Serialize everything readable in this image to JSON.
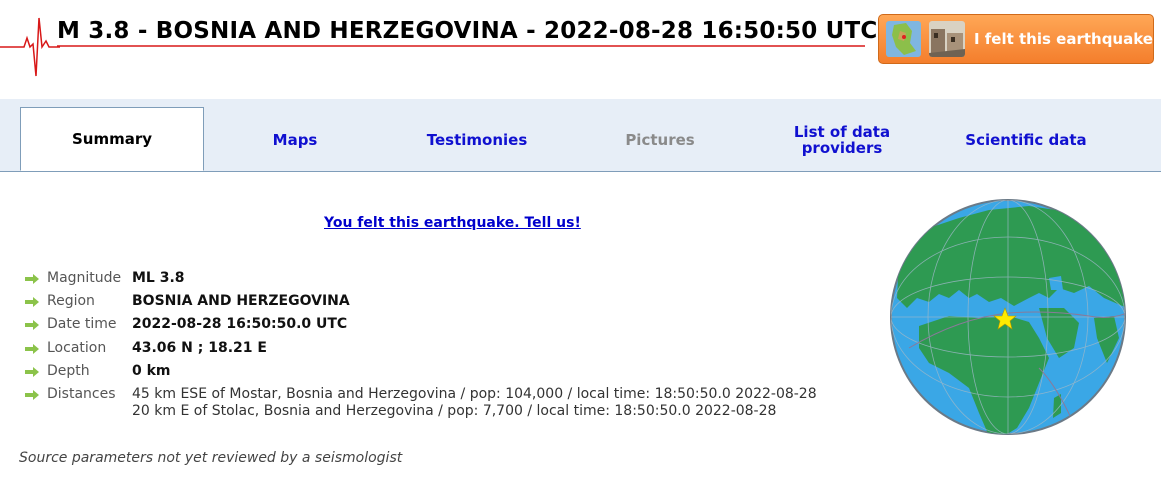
{
  "header": {
    "title": "M 3.8 - BOSNIA AND HERZEGOVINA - 2022-08-28 16:50:50 UTC",
    "felt_button_label": "I felt this earthquake"
  },
  "tabs": [
    {
      "label": "Summary",
      "state": "active"
    },
    {
      "label": "Maps",
      "state": "enabled"
    },
    {
      "label": "Testimonies",
      "state": "enabled"
    },
    {
      "label": "Pictures",
      "state": "disabled"
    },
    {
      "label": "List of data providers",
      "state": "enabled"
    },
    {
      "label": "Scientific data",
      "state": "enabled"
    }
  ],
  "tell_us_link": "You felt this earthquake. Tell us!",
  "params": {
    "magnitude": {
      "label": "Magnitude",
      "value": "ML 3.8"
    },
    "region": {
      "label": "Region",
      "value": "BOSNIA AND HERZEGOVINA"
    },
    "datetime": {
      "label": "Date time",
      "value": "2022-08-28 16:50:50.0 UTC"
    },
    "location": {
      "label": "Location",
      "value": "43.06 N ; 18.21 E"
    },
    "depth": {
      "label": "Depth",
      "value": "0 km"
    },
    "distances": {
      "label": "Distances",
      "lines": [
        "45 km ESE of Mostar, Bosnia and Herzegovina / pop: 104,000 / local time: 18:50:50.0 2022-08-28",
        "20 km E of Stolac, Bosnia and Herzegovina / pop: 7,700 / local time: 18:50:50.0 2022-08-28"
      ]
    }
  },
  "review_note": "Source parameters not yet reviewed by a seismologist",
  "colors": {
    "accent_link": "#1010d0",
    "tab_bar": "#e7eef7",
    "button_orange": "#f47e2c",
    "ocean": "#3aa7e6",
    "land": "#2e9a52",
    "epicenter": "#ffeb00"
  }
}
